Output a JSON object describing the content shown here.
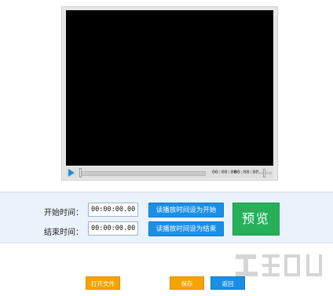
{
  "player": {
    "current_time": "00:00:00",
    "total_time": "00:00:00"
  },
  "form": {
    "start_label": "开始时间：",
    "start_value": "00:00:00.000",
    "end_label": "结束时间：",
    "end_value": "00:00:00.000",
    "set_start_button": "读播放时间设为开始",
    "set_end_button": "读播放时间设为结束",
    "preview_button": "预览"
  },
  "bottom": {
    "open_file": "打开文件",
    "save": "保存",
    "back": "返回"
  },
  "colors": {
    "blue": "#1b8fe6",
    "green": "#26b05a",
    "orange": "#f5a300"
  }
}
